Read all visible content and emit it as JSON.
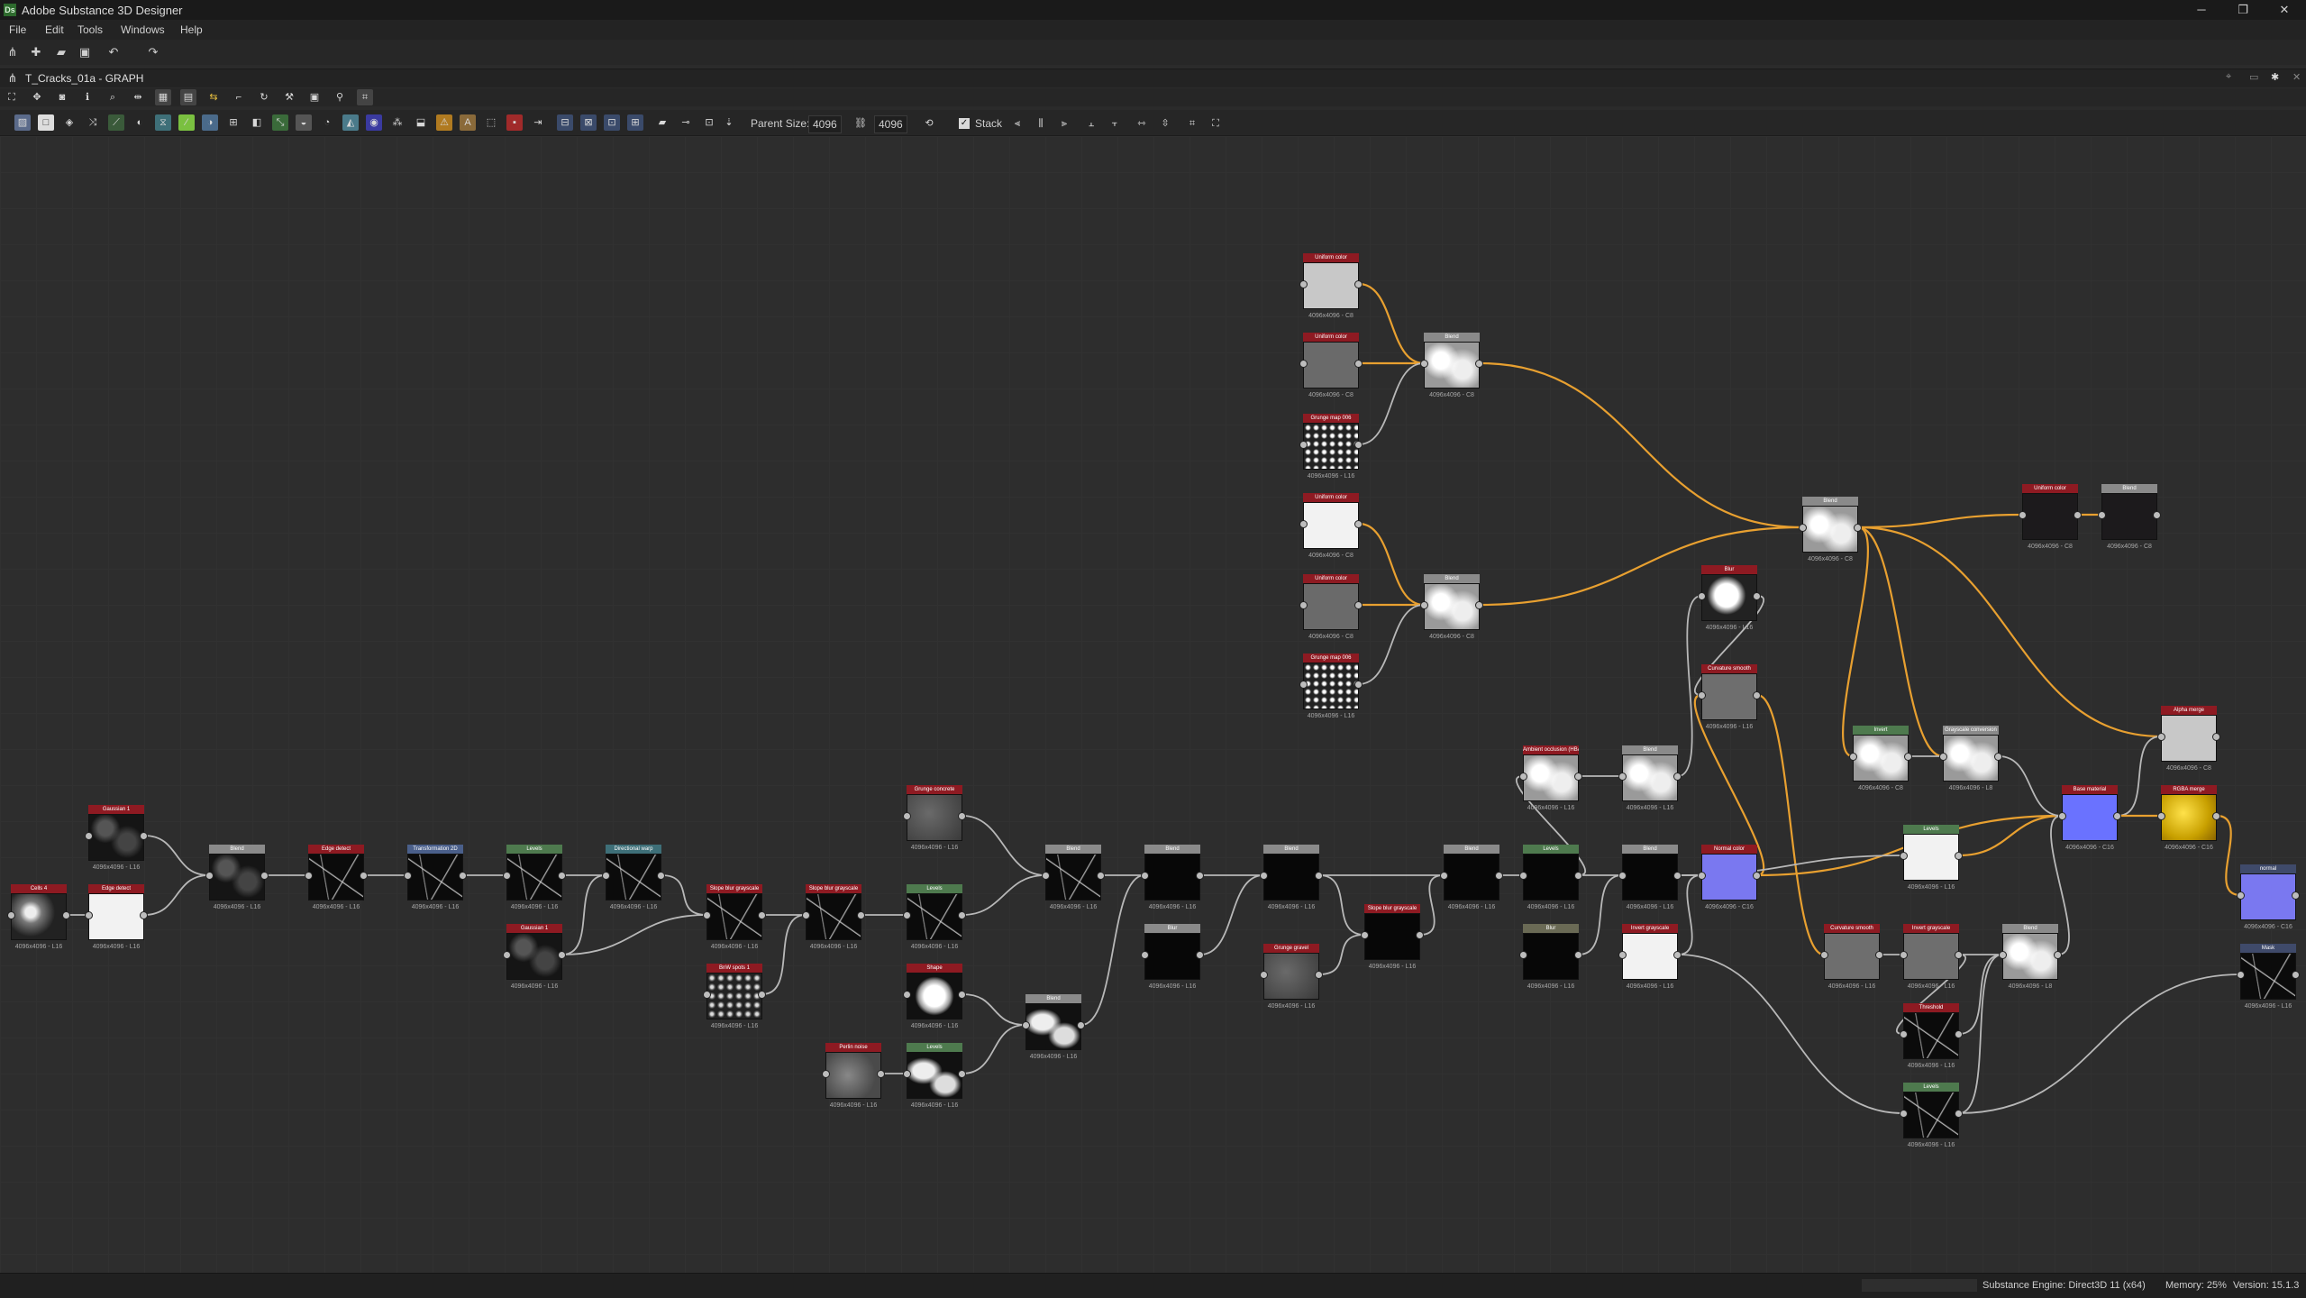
{
  "app": {
    "title": "Adobe Substance 3D Designer",
    "logo": "Ds"
  },
  "window_controls": {
    "minimize": "─",
    "maximize": "❐",
    "close": "✕"
  },
  "menu": [
    "File",
    "Edit",
    "Tools",
    "Windows",
    "Help"
  ],
  "graph": {
    "title": "T_Cracks_01a - GRAPH"
  },
  "graph_toolbar": {
    "parent_size_label": "Parent Size:",
    "parent_size_value": "4096",
    "size_value": "4096",
    "stack_label": "Stack",
    "stack_checked": true
  },
  "nodes": [
    {
      "id": "n1",
      "title": "Cells 4",
      "head": "#8e1a22",
      "thumb": "cells",
      "res": "4096x4096 - L16"
    },
    {
      "id": "n2",
      "title": "Gaussian 1",
      "head": "#8e1a22",
      "thumb": "noise_dark",
      "res": "4096x4096 - L16"
    },
    {
      "id": "n3",
      "title": "Edge detect",
      "head": "#8e1a22",
      "thumb": "white",
      "res": "4096x4096 - L16"
    },
    {
      "id": "n4",
      "title": "Blend",
      "head": "#8a8a8a",
      "thumb": "noise_dark",
      "res": "4096x4096 - L16"
    },
    {
      "id": "n5",
      "title": "Edge detect",
      "head": "#8e1a22",
      "thumb": "cracks",
      "res": "4096x4096 - L16"
    },
    {
      "id": "n6",
      "title": "Transformation 2D",
      "head": "#4a5f8a",
      "thumb": "cracks",
      "res": "4096x4096 - L16"
    },
    {
      "id": "n7",
      "title": "Levels",
      "head": "#4e7a4e",
      "thumb": "cracks",
      "res": "4096x4096 - L16"
    },
    {
      "id": "n8",
      "title": "Gaussian 1",
      "head": "#8e1a22",
      "thumb": "noise_dark",
      "res": "4096x4096 - L16"
    },
    {
      "id": "n9",
      "title": "Directional warp",
      "head": "#3e6f78",
      "thumb": "cracks",
      "res": "4096x4096 - L16"
    },
    {
      "id": "n10",
      "title": "Slope blur grayscale",
      "head": "#8e1a22",
      "thumb": "cracks",
      "res": "4096x4096 - L16"
    },
    {
      "id": "n11",
      "title": "BnW spots 1",
      "head": "#8e1a22",
      "thumb": "spots",
      "res": "4096x4096 - L16"
    },
    {
      "id": "n12",
      "title": "Slope blur grayscale",
      "head": "#8e1a22",
      "thumb": "cracks",
      "res": "4096x4096 - L16"
    },
    {
      "id": "n13",
      "title": "Grunge concrete",
      "head": "#8e1a22",
      "thumb": "grunge",
      "res": "4096x4096 - L16"
    },
    {
      "id": "n14",
      "title": "Levels",
      "head": "#4e7a4e",
      "thumb": "cracks",
      "res": "4096x4096 - L16"
    },
    {
      "id": "n15",
      "title": "Shape",
      "head": "#8e1a22",
      "thumb": "sphere",
      "res": "4096x4096 - L16"
    },
    {
      "id": "n16",
      "title": "Perlin noise",
      "head": "#8e1a22",
      "thumb": "perlin",
      "res": "4096x4096 - L16"
    },
    {
      "id": "n17",
      "title": "Levels",
      "head": "#4e7a4e",
      "thumb": "blobs",
      "res": "4096x4096 - L16"
    },
    {
      "id": "n18",
      "title": "Blend",
      "head": "#8a8a8a",
      "thumb": "cracks",
      "res": "4096x4096 - L16"
    },
    {
      "id": "n19",
      "title": "Blend",
      "head": "#8a8a8a",
      "thumb": "blobs",
      "res": "4096x4096 - L16"
    },
    {
      "id": "n20",
      "title": "Blend",
      "head": "#8a8a8a",
      "thumb": "black",
      "res": "4096x4096 - L16"
    },
    {
      "id": "n21",
      "title": "Blur",
      "head": "#8a8a8a",
      "thumb": "black",
      "res": "4096x4096 - L16"
    },
    {
      "id": "n22",
      "title": "Blend",
      "head": "#8a8a8a",
      "thumb": "black",
      "res": "4096x4096 - L16"
    },
    {
      "id": "n23",
      "title": "Grunge gravel",
      "head": "#8e1a22",
      "thumb": "grunge",
      "res": "4096x4096 - L16"
    },
    {
      "id": "n24",
      "title": "Slope blur grayscale",
      "head": "#8e1a22",
      "thumb": "black",
      "res": "4096x4096 - L16"
    },
    {
      "id": "n25",
      "title": "Blend",
      "head": "#8a8a8a",
      "thumb": "black",
      "res": "4096x4096 - L16"
    },
    {
      "id": "n26",
      "title": "Levels",
      "head": "#4e7a4e",
      "thumb": "black",
      "res": "4096x4096 - L16"
    },
    {
      "id": "n27",
      "title": "Blur",
      "head": "#6a6a55",
      "thumb": "black",
      "res": "4096x4096 - L16"
    },
    {
      "id": "n28",
      "title": "Ambient occlusion (HBAO)",
      "head": "#8e1a22",
      "thumb": "clouds",
      "res": "4096x4096 - L16"
    },
    {
      "id": "n29",
      "title": "Blend",
      "head": "#8a8a8a",
      "thumb": "clouds",
      "res": "4096x4096 - L16"
    },
    {
      "id": "n30",
      "title": "Blend",
      "head": "#8a8a8a",
      "thumb": "black",
      "res": "4096x4096 - L16"
    },
    {
      "id": "n31",
      "title": "Invert grayscale",
      "head": "#8e1a22",
      "thumb": "white",
      "res": "4096x4096 - L16"
    },
    {
      "id": "n32",
      "title": "Normal color",
      "head": "#8e1a22",
      "thumb": "normal",
      "res": "4096x4096 - C16"
    },
    {
      "id": "n33",
      "title": "Blur",
      "head": "#8e1a22",
      "thumb": "clouds_bw",
      "res": "4096x4096 - L16"
    },
    {
      "id": "n34",
      "title": "Curvature smooth",
      "head": "#8e1a22",
      "thumb": "gray",
      "res": "4096x4096 - L16"
    },
    {
      "id": "n35",
      "title": "Uniform color",
      "head": "#8e1a22",
      "thumb": "lightgray",
      "res": "4096x4096 - C8"
    },
    {
      "id": "n36",
      "title": "Uniform color",
      "head": "#8e1a22",
      "thumb": "midgray",
      "res": "4096x4096 - C8"
    },
    {
      "id": "n37",
      "title": "Grunge map 006",
      "head": "#8e1a22",
      "thumb": "grunge_bw",
      "res": "4096x4096 - L16"
    },
    {
      "id": "n38",
      "title": "Blend",
      "head": "#8a8a8a",
      "thumb": "clouds",
      "res": "4096x4096 - C8"
    },
    {
      "id": "n39",
      "title": "Uniform color",
      "head": "#8e1a22",
      "thumb": "white",
      "res": "4096x4096 - C8"
    },
    {
      "id": "n40",
      "title": "Uniform color",
      "head": "#8e1a22",
      "thumb": "midgray",
      "res": "4096x4096 - C8"
    },
    {
      "id": "n41",
      "title": "Grunge map 006",
      "head": "#8e1a22",
      "thumb": "grunge_bw",
      "res": "4096x4096 - L16"
    },
    {
      "id": "n42",
      "title": "Blend",
      "head": "#8a8a8a",
      "thumb": "clouds",
      "res": "4096x4096 - C8"
    },
    {
      "id": "n43",
      "title": "Blend",
      "head": "#8a8a8a",
      "thumb": "clouds",
      "res": "4096x4096 - C8"
    },
    {
      "id": "n44",
      "title": "Uniform color",
      "head": "#8e1a22",
      "thumb": "dark",
      "res": "4096x4096 - C8"
    },
    {
      "id": "n45",
      "title": "Blend",
      "head": "#8a8a8a",
      "thumb": "dark",
      "res": "4096x4096 - C8"
    },
    {
      "id": "n46",
      "title": "Levels",
      "head": "#4e7a4e",
      "thumb": "white",
      "res": "4096x4096 - L16"
    },
    {
      "id": "n47",
      "title": "Invert",
      "head": "#4e7a4e",
      "thumb": "clouds",
      "res": "4096x4096 - C8"
    },
    {
      "id": "n48",
      "title": "Grayscale conversion",
      "head": "#8a8a8a",
      "thumb": "clouds",
      "res": "4096x4096 - L8"
    },
    {
      "id": "n49",
      "title": "Curvature smooth",
      "head": "#8e1a22",
      "thumb": "gray",
      "res": "4096x4096 - L16"
    },
    {
      "id": "n50",
      "title": "Invert grayscale",
      "head": "#8e1a22",
      "thumb": "gray",
      "res": "4096x4096 - L16"
    },
    {
      "id": "n51",
      "title": "Threshold",
      "head": "#8e1a22",
      "thumb": "cracks",
      "res": "4096x4096 - L16"
    },
    {
      "id": "n52",
      "title": "Levels",
      "head": "#4e7a4e",
      "thumb": "cracks",
      "res": "4096x4096 - L16"
    },
    {
      "id": "n53",
      "title": "Blend",
      "head": "#8a8a8a",
      "thumb": "clouds",
      "res": "4096x4096 - L8"
    },
    {
      "id": "n54",
      "title": "Base material",
      "head": "#8e1a22",
      "thumb": "material",
      "res": "4096x4096 - C16"
    },
    {
      "id": "n55",
      "title": "Alpha merge",
      "head": "#8e1a22",
      "thumb": "lightgray",
      "res": "4096x4096 - C8"
    },
    {
      "id": "n56",
      "title": "RGBA merge",
      "head": "#8e1a22",
      "thumb": "yellow",
      "res": "4096x4096 - C16"
    },
    {
      "id": "n57",
      "title": "normal",
      "head": "#3f4a6a",
      "thumb": "normal",
      "res": "4096x4096 - C16"
    },
    {
      "id": "n58",
      "title": "Mask",
      "head": "#3f4a6a",
      "thumb": "cracks",
      "res": "4096x4096 - L16"
    }
  ],
  "status": {
    "engine": "Substance Engine: Direct3D 11 (x64)",
    "memory": "Memory: 25%",
    "version": "Version: 15.1.3"
  },
  "colors": {
    "wire_gray": "#b8b8b8",
    "wire_orange": "#e8a030",
    "accent_red": "#8e1a22"
  }
}
